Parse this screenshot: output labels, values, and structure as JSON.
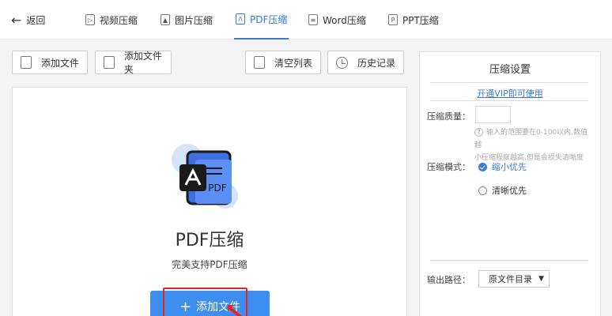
{
  "topbar": {
    "back_label": "返回",
    "tabs": [
      {
        "label": "视频压缩",
        "icon": "video-file-icon"
      },
      {
        "label": "图片压缩",
        "icon": "image-file-icon"
      },
      {
        "label": "PDF压缩",
        "icon": "pdf-file-icon",
        "active": true
      },
      {
        "label": "Word压缩",
        "icon": "word-file-icon"
      },
      {
        "label": "PPT压缩",
        "icon": "ppt-file-icon"
      }
    ]
  },
  "toolbar": {
    "add_file": "添加文件",
    "add_folder": "添加文件夹",
    "clear_list": "清空列表",
    "history": "历史记录"
  },
  "drop_area": {
    "title": "PDF压缩",
    "subtitle": "完美支持PDF压缩",
    "add_button": "添加文件",
    "pdf_badge": "PDF"
  },
  "settings": {
    "title": "压缩设置",
    "vip_link": "开通VIP即可使用",
    "quality_label": "压缩质量：",
    "quality_value": "",
    "hint_line1": "输入的范围要在0-100以内,数值越",
    "hint_line2": "小压缩程度越高,但是会损失清晰度",
    "mode_label": "压缩模式：",
    "mode_options": [
      "缩小优先",
      "清晰优先"
    ],
    "selected_mode": "缩小优先",
    "output_label": "输出路径：",
    "output_value": "原文件目录"
  },
  "colors": {
    "accent": "#3a7bd5",
    "primary_button": "#3d8ef0",
    "highlight": "#e0262a"
  }
}
